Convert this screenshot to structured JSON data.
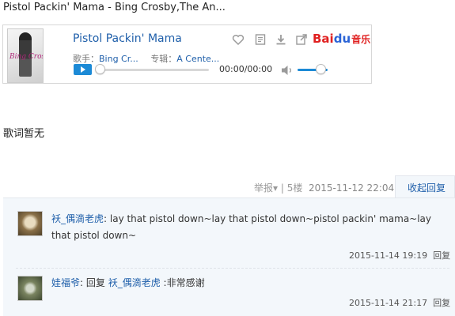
{
  "post": {
    "title": "Pistol Packin' Mama - Bing Crosby,The An..."
  },
  "player": {
    "album_art_text": "Bing Crosby",
    "song_title": "Pistol Packin' Mama",
    "singer_label": "歌手：",
    "singer": "Bing Cr...",
    "album_label": "专辑：",
    "album": "A Cente...",
    "time": "00:00/00:00",
    "progress": 0,
    "volume": 0.75,
    "brand": {
      "bai": "Bai",
      "du": "du",
      "music": "音乐"
    },
    "icons": [
      "heart-icon",
      "notes-icon",
      "download-icon",
      "share-icon",
      "play-icon",
      "volume-icon"
    ],
    "accent_color": "#1c8ad6"
  },
  "lyrics": {
    "empty_label": "歌词暂无"
  },
  "floor": {
    "report": "举报",
    "report_arrow": "▾",
    "sep": " | ",
    "floor_num": "5楼",
    "date": "2015-11-12 22:04",
    "collapse_label": "收起回复"
  },
  "replies": [
    {
      "user": "袄_偶滴老虎",
      "colon": ": ",
      "text": "lay that pistol down~lay that pistol down~pistol packin' mama~lay that pistol down~",
      "time": "2015-11-14 19:19",
      "reply_label": "回复"
    },
    {
      "user": "娃福爷",
      "colon": ": ",
      "reply_word": "回复 ",
      "target_user": "袄_偶滴老虎",
      "text": " :非常感谢",
      "time": "2015-11-14 21:17",
      "reply_label": "回复"
    }
  ],
  "colors": {
    "link": "#1f5faa",
    "panel_bg": "#f3f7fb",
    "brand_red": "#e02020",
    "brand_blue": "#2a63d6"
  }
}
